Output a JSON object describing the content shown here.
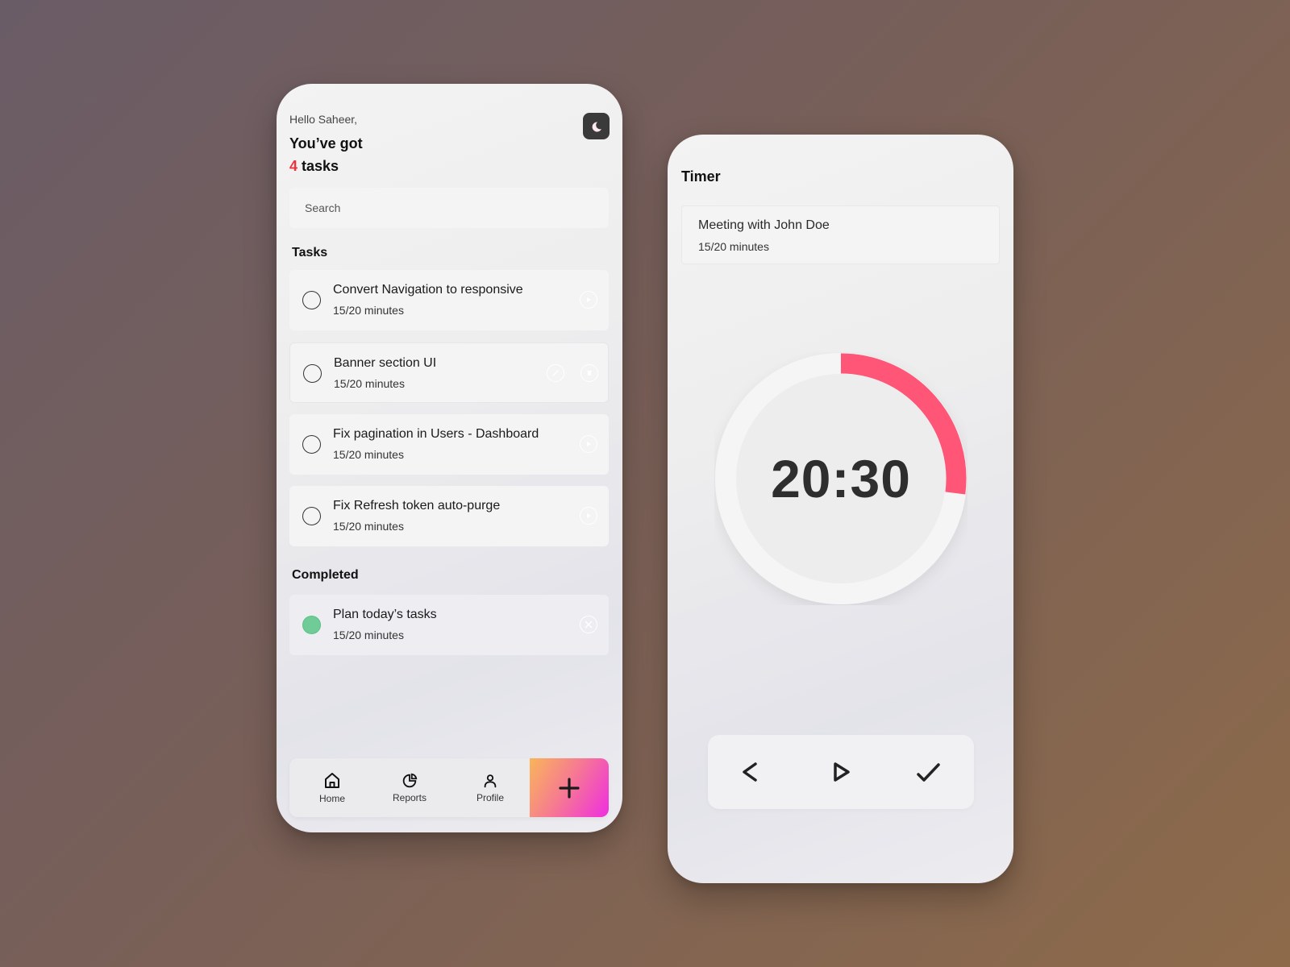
{
  "home": {
    "greeting": "Hello Saheer,",
    "headline_line1": "You’ve got",
    "task_count": "4",
    "task_count_suffix": " tasks",
    "theme_toggle_icon": "moon-icon",
    "search": {
      "placeholder": "Search",
      "value": ""
    },
    "tasks_section_title": "Tasks",
    "tasks": [
      {
        "title": "Convert Navigation to responsive",
        "progress": "15/20 minutes",
        "status": "pending",
        "actions": [
          "play-icon"
        ]
      },
      {
        "title": "Banner section UI",
        "progress": "15/20 minutes",
        "status": "pending",
        "actions": [
          "edit-icon",
          "delete-icon"
        ]
      },
      {
        "title": "Fix pagination in Users - Dashboard",
        "progress": "15/20 minutes",
        "status": "pending",
        "actions": [
          "play-icon"
        ]
      },
      {
        "title": "Fix Refresh token auto-purge",
        "progress": "15/20 minutes",
        "status": "pending",
        "actions": [
          "play-icon"
        ]
      }
    ],
    "completed_section_title": "Completed",
    "completed": [
      {
        "title": "Plan today’s tasks",
        "progress": "15/20 minutes",
        "status": "done",
        "actions": [
          "close-icon"
        ]
      }
    ],
    "nav": {
      "items": [
        {
          "label": "Home",
          "icon": "home-icon"
        },
        {
          "label": "Reports",
          "icon": "pie-chart-icon"
        },
        {
          "label": "Profile",
          "icon": "user-icon"
        }
      ],
      "add_icon": "plus-icon"
    }
  },
  "timer": {
    "title": "Timer",
    "current_task": {
      "title": "Meeting with John Doe",
      "progress": "15/20 minutes"
    },
    "display": "20:30",
    "ring_progress_fraction": 0.27,
    "controls": [
      {
        "name": "back",
        "icon": "chevron-left-icon"
      },
      {
        "name": "play",
        "icon": "play-icon"
      },
      {
        "name": "complete",
        "icon": "check-icon"
      }
    ]
  },
  "colors": {
    "accent_red": "#f0303a",
    "ring_progress": "#ff5577",
    "completed_green": "#6fcc96",
    "add_gradient_start": "#f9b55a",
    "add_gradient_end": "#ef2ee0"
  }
}
